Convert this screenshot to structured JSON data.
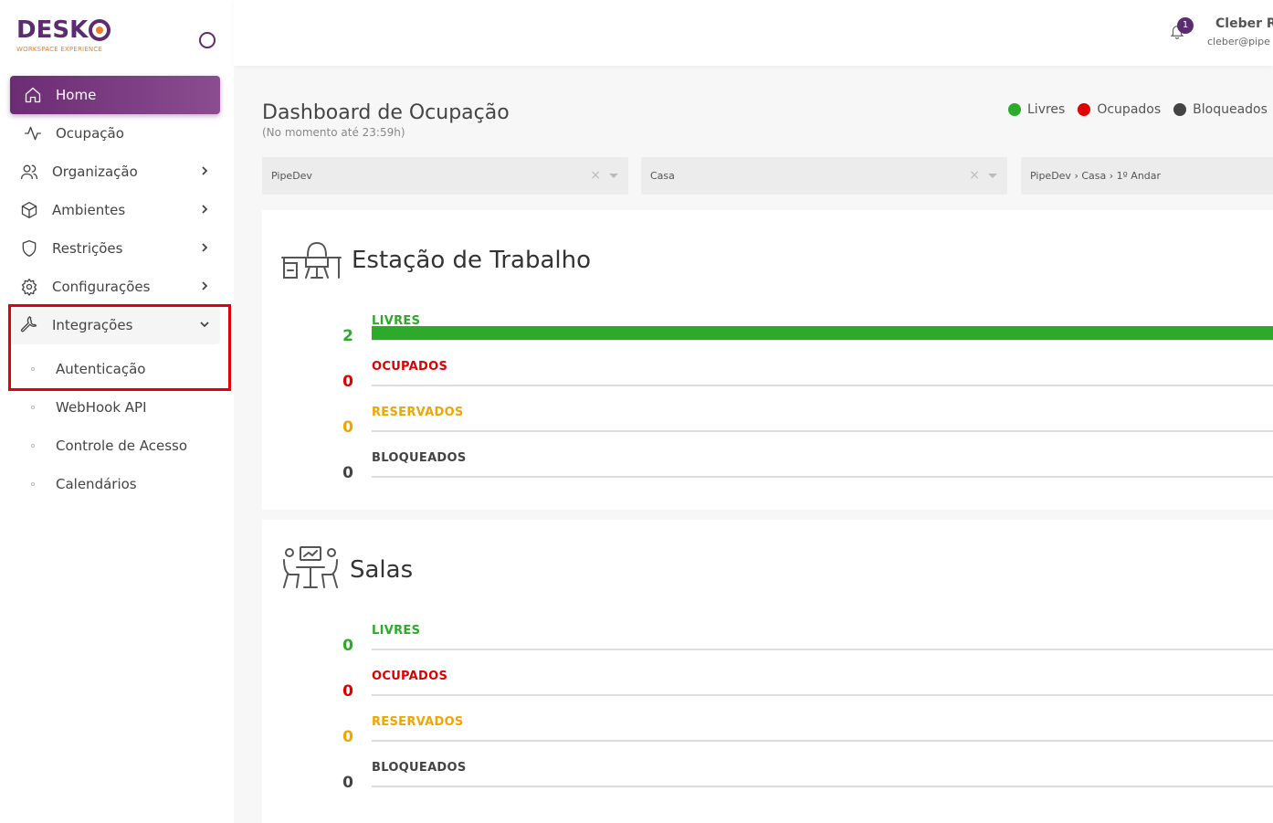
{
  "brand": {
    "name": "DESK",
    "tagline": "WORKSPACE EXPERIENCE"
  },
  "sidebar": {
    "items": [
      {
        "label": "Home",
        "icon": "home-icon"
      },
      {
        "label": "Ocupação",
        "icon": "activity-icon"
      },
      {
        "label": "Organização",
        "icon": "users-icon"
      },
      {
        "label": "Ambientes",
        "icon": "box-icon"
      },
      {
        "label": "Restrições",
        "icon": "shield-icon"
      },
      {
        "label": "Configurações",
        "icon": "gear-icon"
      },
      {
        "label": "Integrações",
        "icon": "wrench-icon"
      }
    ],
    "subitems": [
      {
        "label": "Autenticação"
      },
      {
        "label": "WebHook API"
      },
      {
        "label": "Controle de Acesso"
      },
      {
        "label": "Calendários"
      }
    ]
  },
  "header": {
    "notification_count": "1",
    "user_name": "Cleber R",
    "user_email": "cleber@pipe"
  },
  "page": {
    "title": "Dashboard de Ocupação",
    "subtitle": "(No momento até 23:59h)",
    "legend": [
      {
        "label": "Livres",
        "color": "#2eaa2a"
      },
      {
        "label": "Ocupados",
        "color": "#e00000"
      },
      {
        "label": "Bloqueados",
        "color": "#444444"
      }
    ]
  },
  "filters": [
    {
      "value": "PipeDev"
    },
    {
      "value": "Casa"
    },
    {
      "value": "PipeDev › Casa › 1º Andar"
    }
  ],
  "cards": [
    {
      "title": "Estação de Trabalho",
      "icon": "workstation-icon",
      "stats": [
        {
          "label": "LIVRES",
          "value": "2",
          "fill": 1.0
        },
        {
          "label": "OCUPADOS",
          "value": "0",
          "fill": 0
        },
        {
          "label": "RESERVADOS",
          "value": "0",
          "fill": 0
        },
        {
          "label": "BLOQUEADOS",
          "value": "0",
          "fill": 0
        }
      ]
    },
    {
      "title": "Salas",
      "icon": "meeting-room-icon",
      "stats": [
        {
          "label": "LIVRES",
          "value": "0",
          "fill": 0
        },
        {
          "label": "OCUPADOS",
          "value": "0",
          "fill": 0
        },
        {
          "label": "RESERVADOS",
          "value": "0",
          "fill": 0
        },
        {
          "label": "BLOQUEADOS",
          "value": "0",
          "fill": 0
        }
      ]
    }
  ]
}
